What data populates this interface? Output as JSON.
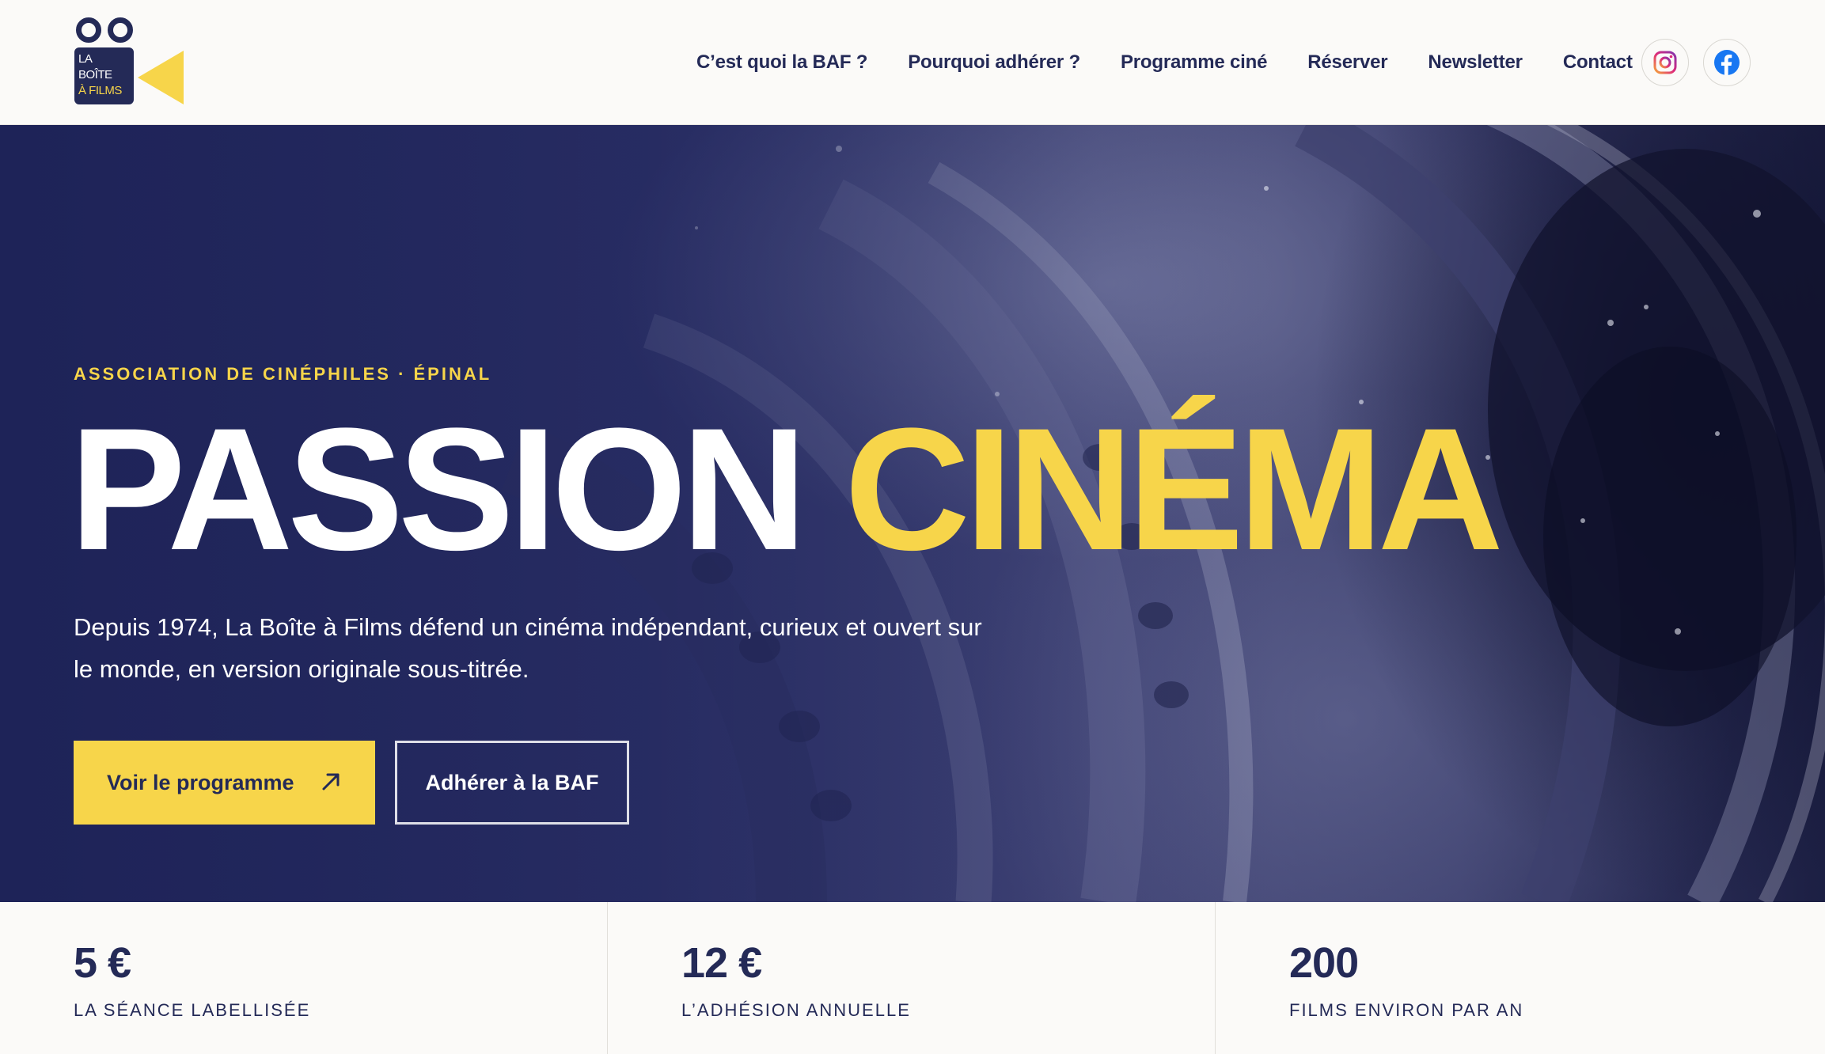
{
  "logo": {
    "lines": [
      "LA",
      "BOÎTE",
      "À FILMS"
    ]
  },
  "nav": {
    "items": [
      {
        "label": "C’est quoi la BAF ?"
      },
      {
        "label": "Pourquoi adhérer ?"
      },
      {
        "label": "Programme ciné"
      },
      {
        "label": "Réserver"
      },
      {
        "label": "Newsletter"
      },
      {
        "label": "Contact"
      }
    ],
    "social": [
      {
        "icon": "instagram-icon",
        "color": "#d6336c"
      },
      {
        "icon": "facebook-icon",
        "color": "#1877f2"
      }
    ]
  },
  "hero": {
    "eyebrow": "ASSOCIATION DE CINÉPHILES · ÉPINAL",
    "title_white": "PASSION",
    "title_yellow": "CINÉMA",
    "lead": "Depuis 1974, La Boîte à Films défend un cinéma indépendant, curieux et ouvert sur le monde, en version originale sous-titrée.",
    "primary_button": "Voir le programme",
    "primary_button_icon": "arrow-up-right-icon",
    "secondary_button": "Adhérer à la BAF"
  },
  "stats": [
    {
      "value": "5 €",
      "label": "LA SÉANCE LABELLISÉE"
    },
    {
      "value": "12 €",
      "label": "L’ADHÉSION ANNUELLE"
    },
    {
      "value": "200",
      "label": "FILMS ENVIRON PAR AN"
    }
  ],
  "colors": {
    "navy": "#242a57",
    "yellow": "#f7d54a",
    "background": "#fbfaf8"
  }
}
